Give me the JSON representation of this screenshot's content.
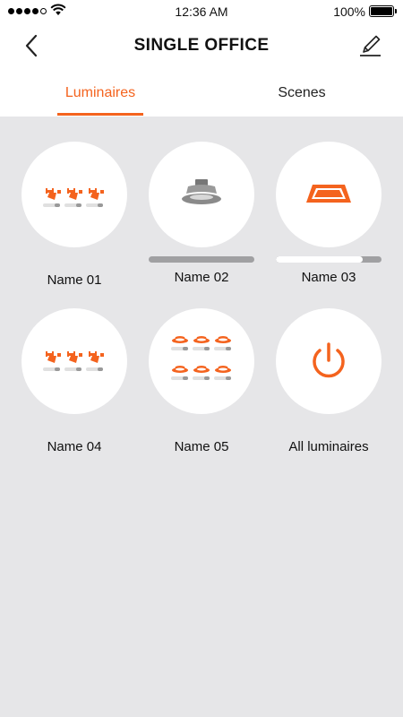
{
  "status_bar": {
    "time": "12:36 AM",
    "battery_pct": "100%",
    "battery_level": 1.0,
    "signal_bars": 4
  },
  "header": {
    "title": "SINGLE OFFICE"
  },
  "tabs": [
    {
      "label": "Luminaires",
      "active": true
    },
    {
      "label": "Scenes",
      "active": false
    }
  ],
  "accent_color": "#f4631e",
  "luminaires": [
    {
      "name": "Name 01",
      "icon": "spotlight-group-icon",
      "level": null
    },
    {
      "name": "Name 02",
      "icon": "downlight-icon",
      "level": 0.0
    },
    {
      "name": "Name 03",
      "icon": "panel-light-icon",
      "level": 0.82
    },
    {
      "name": "Name 04",
      "icon": "spotlight-group-icon",
      "level": null
    },
    {
      "name": "Name 05",
      "icon": "downlight-group-icon",
      "level": null
    },
    {
      "name": "All luminaires",
      "icon": "power-icon",
      "level": null
    }
  ]
}
